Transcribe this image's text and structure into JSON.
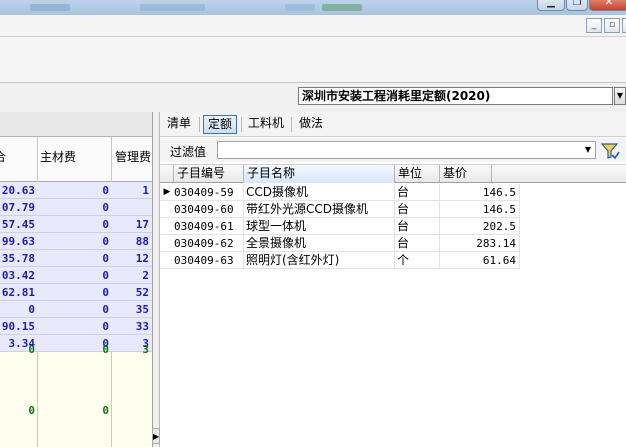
{
  "window": {
    "controls": [
      "minimize-icon",
      "restore-icon",
      "close-icon"
    ],
    "mdi_controls": [
      "minimize-icon",
      "restore-icon"
    ]
  },
  "quota": {
    "selected": "深圳市安装工程消耗里定额(2020)"
  },
  "left_grid": {
    "headers": [
      "合",
      "主材费",
      "管理费"
    ],
    "rows": [
      {
        "total": "20.63",
        "main_material": "0",
        "management": "1"
      },
      {
        "total": "07.79",
        "main_material": "0",
        "management": ""
      },
      {
        "total": "57.45",
        "main_material": "0",
        "management": "17"
      },
      {
        "total": "99.63",
        "main_material": "0",
        "management": "88"
      },
      {
        "total": "35.78",
        "main_material": "0",
        "management": "12"
      },
      {
        "total": "03.42",
        "main_material": "0",
        "management": "2"
      },
      {
        "total": "62.81",
        "main_material": "0",
        "management": "52"
      },
      {
        "total": "0",
        "main_material": "0",
        "management": "35"
      },
      {
        "total": "90.15",
        "main_material": "0",
        "management": "33"
      },
      {
        "total": "3.34",
        "main_material": "0",
        "management": "3"
      }
    ],
    "summary_rows": [
      {
        "total": "0",
        "main_material": "0",
        "management": "3"
      },
      {
        "total": "0",
        "main_material": "0",
        "management": ""
      }
    ]
  },
  "tabs": [
    {
      "label": "清单",
      "active": false
    },
    {
      "label": "定额",
      "active": true
    },
    {
      "label": "工料机",
      "active": false
    },
    {
      "label": "做法",
      "active": false
    }
  ],
  "filter": {
    "label": "过滤值",
    "value": ""
  },
  "sub_grid": {
    "headers": {
      "code": "子目编号",
      "name": "子目名称",
      "unit": "单位",
      "price": "基价"
    },
    "rows": [
      {
        "code": "030409-59",
        "name": "CCD摄像机",
        "unit": "台",
        "price": "146.5",
        "current": true
      },
      {
        "code": "030409-60",
        "name": "带红外光源CCD摄像机",
        "unit": "台",
        "price": "146.5",
        "current": false
      },
      {
        "code": "030409-61",
        "name": "球型一体机",
        "unit": "台",
        "price": "202.5",
        "current": false
      },
      {
        "code": "030409-62",
        "name": "全景摄像机",
        "unit": "台",
        "price": "283.14",
        "current": false
      },
      {
        "code": "030409-63",
        "name": "照明灯(含红外灯)",
        "unit": "个",
        "price": "61.64",
        "current": false
      }
    ]
  },
  "colors": {
    "number_blue": "#1c1cb3",
    "number_green": "#0a7a0a",
    "row_highlight": "#e8e9fd",
    "tab_active_border": "#3b6fb6"
  }
}
